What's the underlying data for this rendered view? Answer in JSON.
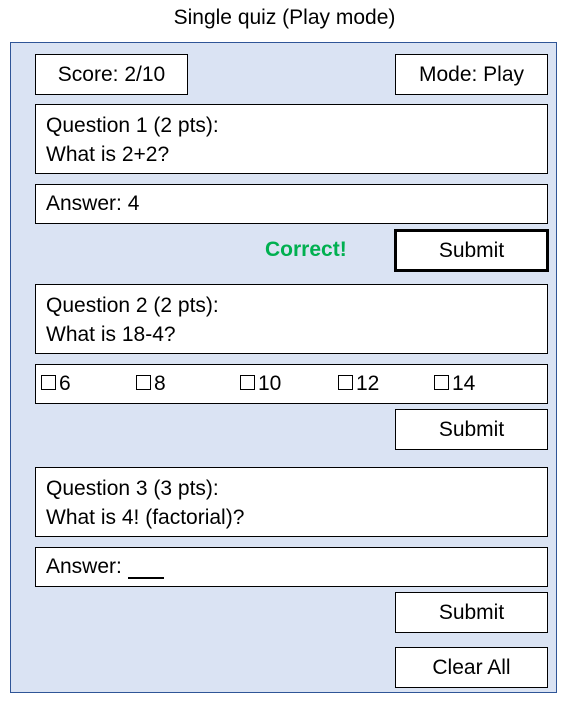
{
  "page": {
    "title": "Single quiz (Play mode)"
  },
  "header": {
    "score": "Score: 2/10",
    "mode": "Mode: Play"
  },
  "q1": {
    "title": "Question 1 (2 pts):",
    "text": "What is 2+2?",
    "answer_label": "Answer:",
    "answer_value": "4",
    "feedback": "Correct!",
    "submit": "Submit"
  },
  "q2": {
    "title": "Question 2 (2 pts):",
    "text": "What is 18-4?",
    "options": [
      "6",
      "8",
      "10",
      "12",
      "14"
    ],
    "submit": "Submit"
  },
  "q3": {
    "title": "Question 3 (3 pts):",
    "text": "What is 4! (factorial)?",
    "answer_label": "Answer:",
    "answer_value": "",
    "submit": "Submit"
  },
  "footer": {
    "clear_all": "Clear All"
  },
  "colors": {
    "panel_bg": "#dae3f3",
    "panel_border": "#2f5597",
    "feedback_correct": "#00b050"
  }
}
